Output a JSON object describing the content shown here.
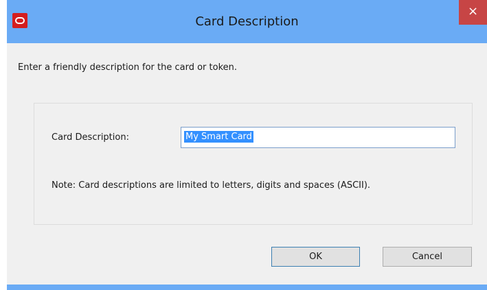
{
  "window": {
    "title": "Card Description",
    "close_glyph": "×",
    "app_icon": "oracle-ring-icon"
  },
  "dialog": {
    "prompt": "Enter a friendly description for the card or token.",
    "field_label": "Card Description:",
    "field_value": "My Smart Card",
    "note": "Note: Card descriptions are limited to letters, digits and spaces (ASCII)."
  },
  "buttons": {
    "ok_label": "OK",
    "cancel_label": "Cancel"
  },
  "colors": {
    "titlebar": "#6aabf5",
    "close_button": "#c74545",
    "selection": "#3390ff",
    "app_icon": "#d41e1e"
  }
}
